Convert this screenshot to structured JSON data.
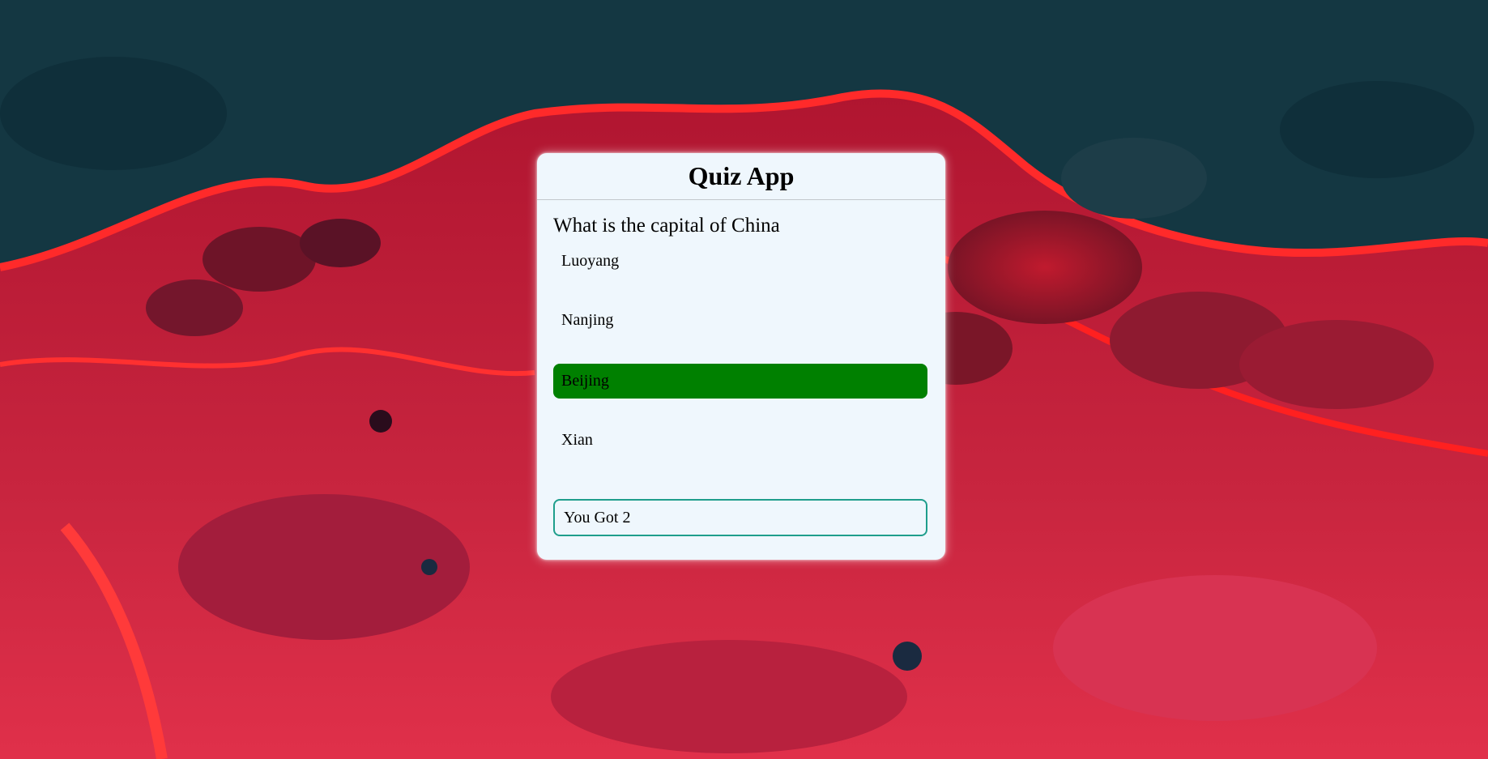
{
  "app": {
    "title": "Quiz App"
  },
  "quiz": {
    "question": "What is the capital of China",
    "options": [
      {
        "label": "Luoyang",
        "state": "default"
      },
      {
        "label": "Nanjing",
        "state": "default"
      },
      {
        "label": "Beijing",
        "state": "correct"
      },
      {
        "label": "Xian",
        "state": "default"
      }
    ],
    "score_text": "You Got 2"
  },
  "colors": {
    "correct": "#008000",
    "score_border": "#1f9e8c",
    "card_background": "#eff7fd"
  }
}
